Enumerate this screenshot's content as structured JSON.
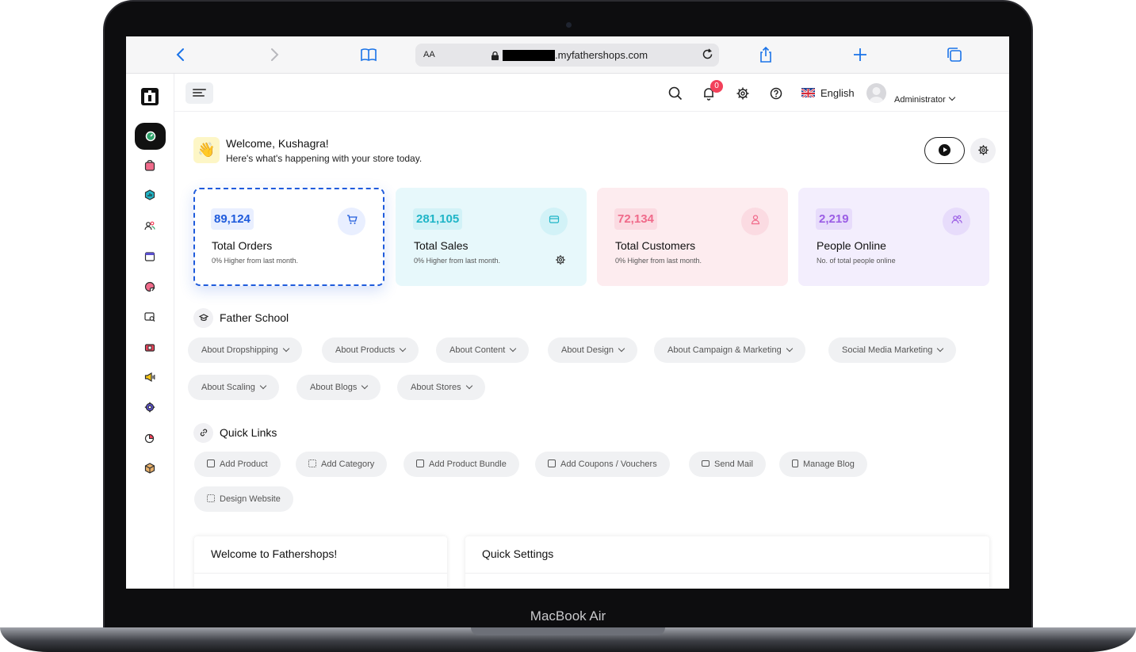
{
  "device": {
    "label": "MacBook Air"
  },
  "browser": {
    "aa_label": "AA",
    "url_suffix": ".myfathershops.com"
  },
  "header": {
    "notification_count": "0",
    "language": "English",
    "role": "Administrator"
  },
  "welcome": {
    "emoji": "👋",
    "title": "Welcome, Kushagra!",
    "subtitle": "Here's what's happening with your store today."
  },
  "stats": [
    {
      "value": "89,124",
      "label": "Total Orders",
      "sub": "0% Higher from last month.",
      "color": "#1f5bdc",
      "bg": "#ffffff",
      "chip": "#e9efff"
    },
    {
      "value": "281,105",
      "label": "Total Sales",
      "sub": "0% Higher from last month.",
      "color": "#1fb5c7",
      "bg": "#e7f8fb",
      "chip": "#d2f2f7"
    },
    {
      "value": "72,134",
      "label": "Total Customers",
      "sub": "0% Higher from last month.",
      "color": "#f06a8a",
      "bg": "#fdecef",
      "chip": "#fbdbe2"
    },
    {
      "value": "2,219",
      "label": "People Online",
      "sub": "No. of total people online",
      "color": "#9b5de5",
      "bg": "#f3eefd",
      "chip": "#e7dcfb"
    }
  ],
  "father_school": {
    "title": "Father School",
    "chips": [
      "About Dropshipping",
      "About Products",
      "About Content",
      "About Design",
      "About Campaign & Marketing",
      "Social Media Marketing",
      "About Scaling",
      "About Blogs",
      "About Stores"
    ]
  },
  "quick_links": {
    "title": "Quick Links",
    "items": [
      "Add Product",
      "Add Category",
      "Add Product Bundle",
      "Add Coupons / Vouchers",
      "Send Mail",
      "Manage Blog",
      "Design Website"
    ]
  },
  "panels": {
    "left_title": "Welcome to Fathershops!",
    "right_title": "Quick Settings"
  },
  "colors": {
    "accent": "#1a73e8",
    "badge": "#f2415a",
    "sidebar_active": "#111111"
  }
}
